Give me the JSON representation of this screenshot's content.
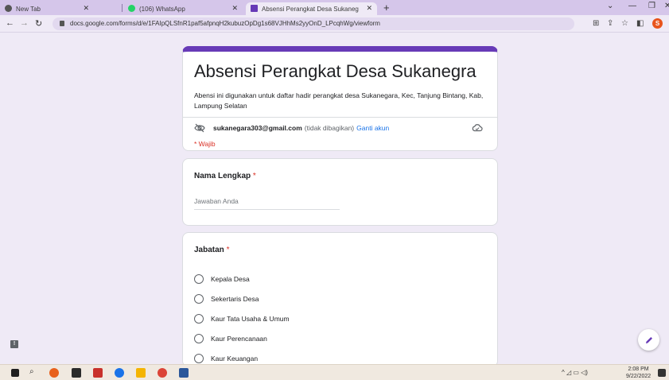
{
  "browser": {
    "tabs": [
      {
        "title": "New Tab",
        "icon": "chrome-icon"
      },
      {
        "title": "(106) WhatsApp",
        "icon": "whatsapp-icon"
      },
      {
        "title": "Absensi Perangkat Desa Sukaneg",
        "icon": "google-forms-icon",
        "active": true
      }
    ],
    "url": "docs.google.com/forms/d/e/1FAIpQLSfnR1paf5afpnqH2kubuzOpDg1s68VJHhMs2yyOnD_LPcqhWg/viewform",
    "profile_initial": "S"
  },
  "form": {
    "accent_color": "#673ab7",
    "title": "Absensi Perangkat Desa Sukanegra",
    "description": "Abensi ini digunakan untuk daftar hadir perangkat desa Sukanegara, Kec, Tanjung Bintang, Kab, Lampung Selatan",
    "account_email": "sukanegara303@gmail.com",
    "not_shared": "(tidak dibagikan)",
    "switch_account": "Ganti akun",
    "required_note": "* Wajib",
    "questions": [
      {
        "title": "Nama Lengkap",
        "required_mark": "*",
        "placeholder": "Jawaban Anda"
      },
      {
        "title": "Jabatan",
        "required_mark": "*",
        "options": [
          "Kepala Desa",
          "Sekertaris Desa",
          "Kaur Tata Usaha & Umum",
          "Kaur Perencanaan",
          "Kaur Keuangan"
        ]
      }
    ]
  },
  "taskbar": {
    "time": "2:08 PM",
    "date": "9/22/2022"
  }
}
